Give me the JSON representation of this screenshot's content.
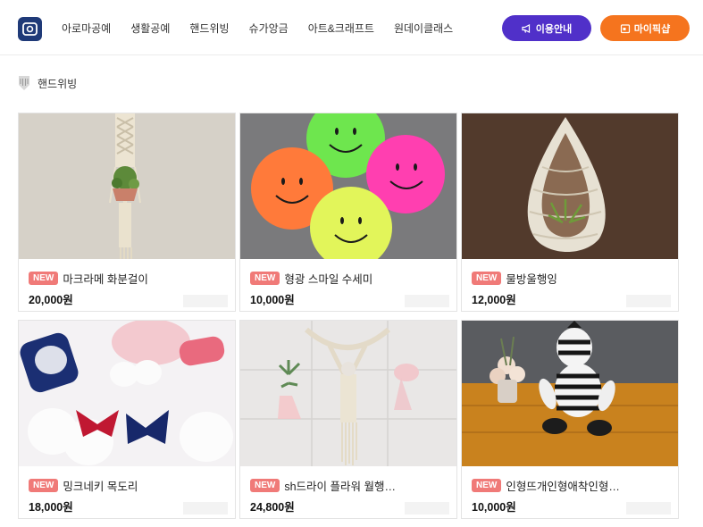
{
  "header": {
    "nav": [
      "아로마공예",
      "생활공예",
      "핸드위빙",
      "슈가앙금",
      "아트&크래프트",
      "원데이클래스"
    ],
    "guide_label": "이용안내",
    "mypage_label": "마이픽샵"
  },
  "breadcrumb": {
    "label": "핸드위빙"
  },
  "products": [
    {
      "badge": "NEW",
      "title": "마크라메 화분걸이",
      "price": "20,000원"
    },
    {
      "badge": "NEW",
      "title": "형광 스마일 수세미",
      "price": "10,000원"
    },
    {
      "badge": "NEW",
      "title": "물방울행잉",
      "price": "12,000원"
    },
    {
      "badge": "NEW",
      "title": "밍크네키 목도리",
      "price": "18,000원"
    },
    {
      "badge": "NEW",
      "title": "sh드라이 플라워 월행…",
      "price": "24,800원"
    },
    {
      "badge": "NEW",
      "title": "인형뜨개인형애착인형…",
      "price": "10,000원"
    }
  ],
  "colors": {
    "brand_navy": "#1f3a78",
    "guide_button": "#5030c9",
    "mypage_button": "#f5741e",
    "new_badge": "#f07a78"
  }
}
